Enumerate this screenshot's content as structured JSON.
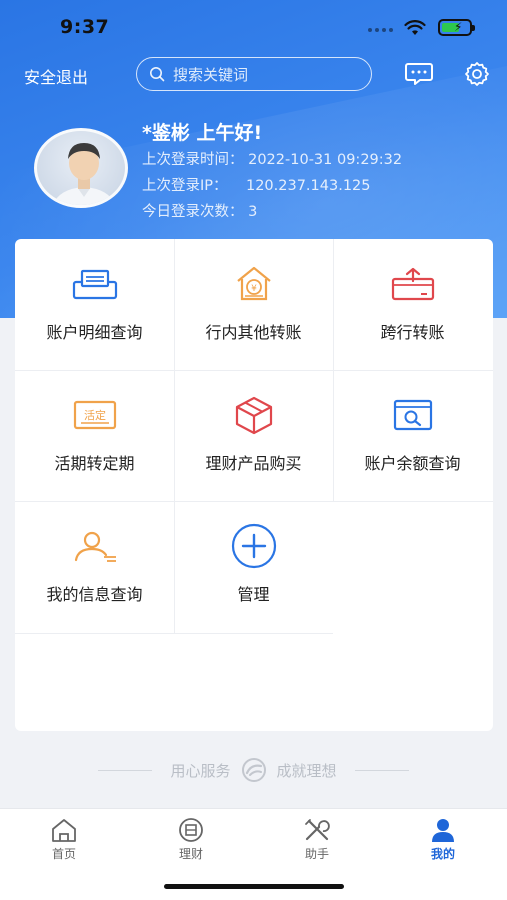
{
  "status_bar": {
    "time": "9:37"
  },
  "header": {
    "logout_label": "安全退出",
    "search_placeholder": "搜索关键词"
  },
  "profile": {
    "greeting": "*鉴彬 上午好!",
    "last_login_time_label": "上次登录时间：",
    "last_login_time": "2022-10-31 09:29:32",
    "last_login_ip_label": "上次登录IP：",
    "last_login_ip": "120.237.143.125",
    "today_logins_label": "今日登录次数：",
    "today_logins": "3"
  },
  "services": [
    {
      "label": "账户明细查询",
      "icon": "account-detail-icon"
    },
    {
      "label": "行内其他转账",
      "icon": "internal-transfer-icon"
    },
    {
      "label": "跨行转账",
      "icon": "interbank-transfer-icon"
    },
    {
      "label": "活期转定期",
      "icon": "current-to-fixed-icon"
    },
    {
      "label": "理财产品购买",
      "icon": "wealth-product-icon"
    },
    {
      "label": "账户余额查询",
      "icon": "balance-query-icon"
    },
    {
      "label": "我的信息查询",
      "icon": "my-info-icon"
    },
    {
      "label": "管理",
      "icon": "add-icon"
    }
  ],
  "icon_text": {
    "fixed_badge": "活定"
  },
  "slogan": {
    "left": "用心服务",
    "right": "成就理想"
  },
  "tabbar": [
    {
      "label": "首页",
      "icon": "home-icon"
    },
    {
      "label": "理财",
      "icon": "wealth-icon"
    },
    {
      "label": "助手",
      "icon": "tools-icon"
    },
    {
      "label": "我的",
      "icon": "user-icon",
      "active": true
    }
  ],
  "colors": {
    "accent": "#2a75e4",
    "orange": "#f0a24a",
    "red": "#e0474c",
    "active_tab": "#1f66d8"
  }
}
